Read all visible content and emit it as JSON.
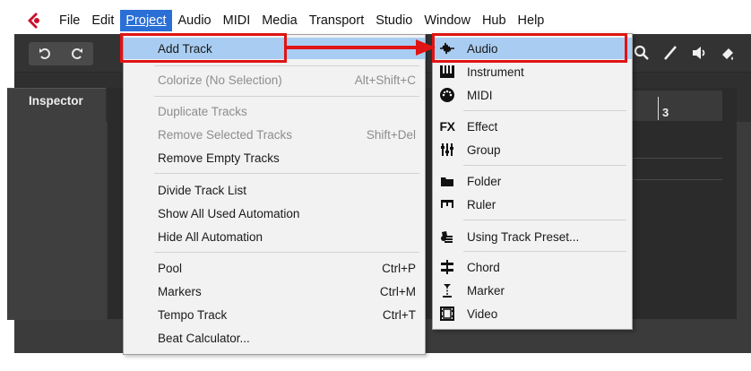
{
  "menubar": {
    "items": [
      "File",
      "Edit",
      "Project",
      "Audio",
      "MIDI",
      "Media",
      "Transport",
      "Studio",
      "Window",
      "Hub",
      "Help"
    ],
    "active_index": 2
  },
  "inspector": {
    "title": "Inspector"
  },
  "ruler": {
    "bar_number": "3"
  },
  "project_menu": {
    "items": [
      {
        "label": "Add Track",
        "shortcut": "",
        "disabled": false,
        "highlight": true
      },
      {
        "label": "Colorize (No Selection)",
        "shortcut": "Alt+Shift+C",
        "disabled": true
      },
      {
        "label": "Duplicate Tracks",
        "shortcut": "",
        "disabled": true
      },
      {
        "label": "Remove Selected Tracks",
        "shortcut": "Shift+Del",
        "disabled": true
      },
      {
        "label": "Remove Empty Tracks",
        "shortcut": "",
        "disabled": false
      },
      {
        "label": "Divide Track List",
        "shortcut": "",
        "disabled": false
      },
      {
        "label": "Show All Used Automation",
        "shortcut": "",
        "disabled": false
      },
      {
        "label": "Hide All Automation",
        "shortcut": "",
        "disabled": false
      },
      {
        "label": "Pool",
        "shortcut": "Ctrl+P",
        "disabled": false
      },
      {
        "label": "Markers",
        "shortcut": "Ctrl+M",
        "disabled": false
      },
      {
        "label": "Tempo Track",
        "shortcut": "Ctrl+T",
        "disabled": false
      },
      {
        "label": "Beat Calculator...",
        "shortcut": "",
        "disabled": false
      }
    ]
  },
  "add_track_submenu": {
    "items": [
      {
        "label": "Audio",
        "icon": "audio-waveform-icon",
        "highlight": true
      },
      {
        "label": "Instrument",
        "icon": "piano-keys-icon"
      },
      {
        "label": "MIDI",
        "icon": "midi-connector-icon"
      },
      {
        "label": "Effect",
        "icon": "fx-icon",
        "icon_text": "FX"
      },
      {
        "label": "Group",
        "icon": "group-faders-icon"
      },
      {
        "label": "Folder",
        "icon": "folder-icon"
      },
      {
        "label": "Ruler",
        "icon": "ruler-icon"
      },
      {
        "label": "Using Track Preset...",
        "icon": "track-preset-icon"
      },
      {
        "label": "Chord",
        "icon": "chord-icon"
      },
      {
        "label": "Marker",
        "icon": "marker-icon"
      },
      {
        "label": "Video",
        "icon": "film-icon"
      }
    ]
  },
  "colors": {
    "menu_highlight": "#a9cdf2",
    "active_menubar": "#2a6fd6",
    "annotation_red": "#e01414",
    "app_background": "#3b3b3b"
  }
}
